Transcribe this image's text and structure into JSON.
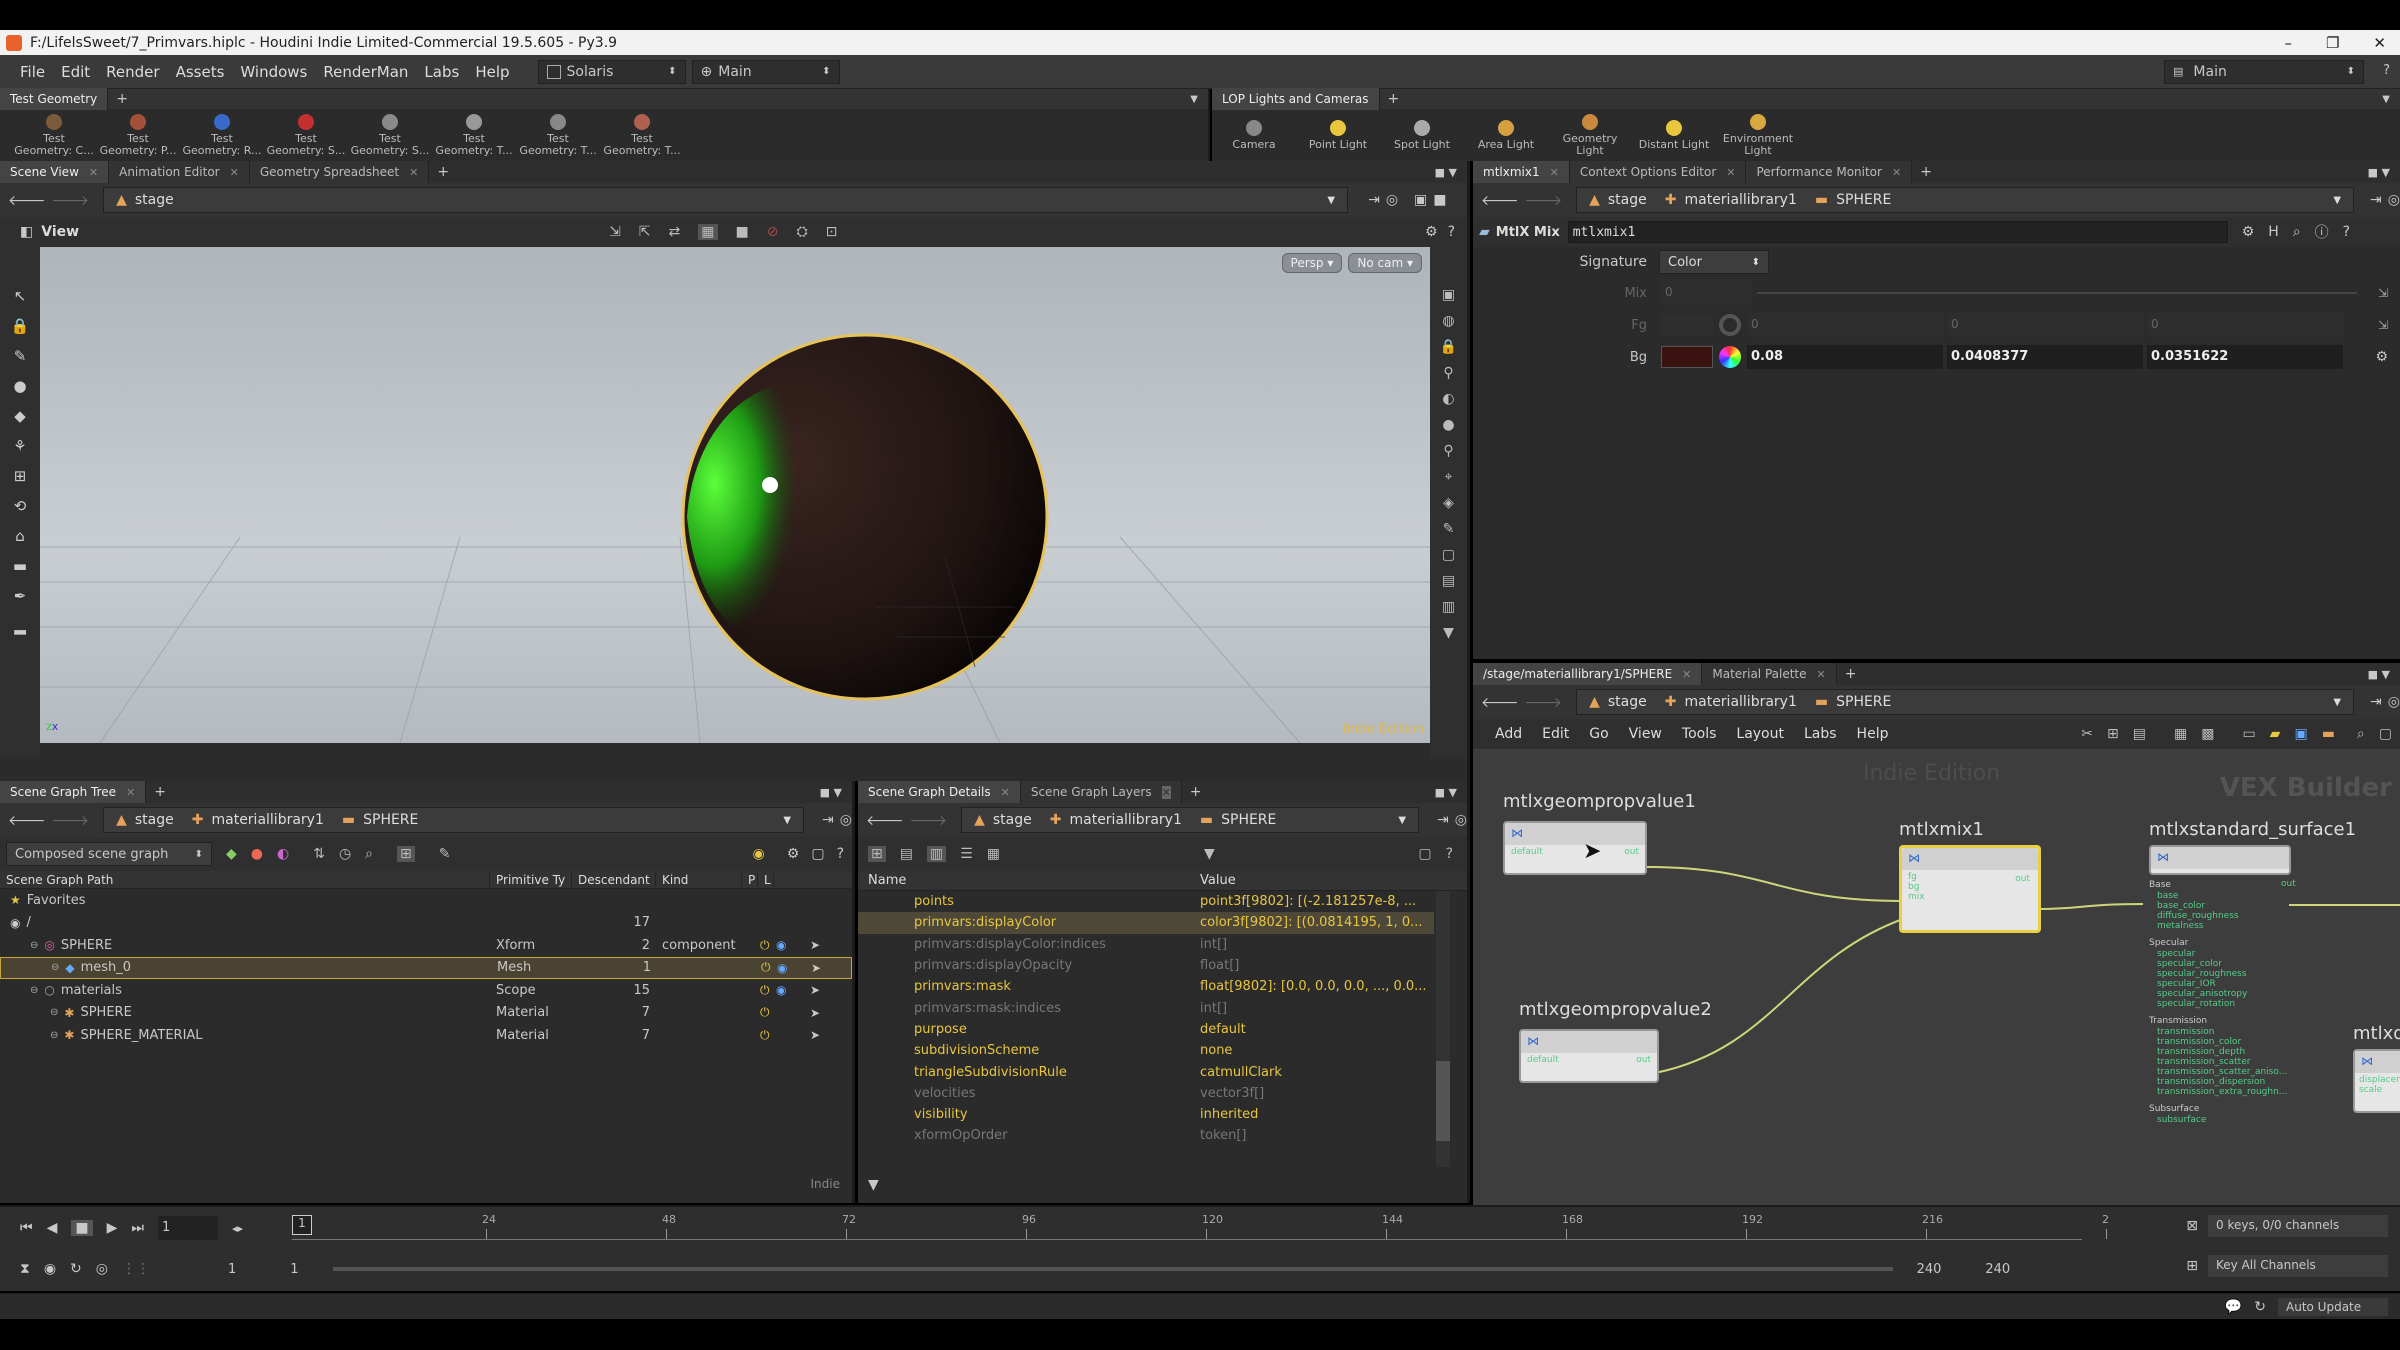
{
  "window": {
    "title": "F:/LifelsSweet/7_Primvars.hiplc - Houdini Indie Limited-Commercial 19.5.605 - Py3.9",
    "minimize": "–",
    "maximize": "❐",
    "close": "✕"
  },
  "menubar": {
    "items": [
      "File",
      "Edit",
      "Render",
      "Assets",
      "Windows",
      "RenderMan",
      "Labs",
      "Help"
    ],
    "context": "Solaris",
    "desktop": "Main",
    "right_desktop": "Main"
  },
  "shelf_left": {
    "tab": "Test Geometry",
    "tools": [
      {
        "l1": "Test",
        "l2": "Geometry: C..."
      },
      {
        "l1": "Test",
        "l2": "Geometry: P..."
      },
      {
        "l1": "Test",
        "l2": "Geometry: R..."
      },
      {
        "l1": "Test",
        "l2": "Geometry: S..."
      },
      {
        "l1": "Test",
        "l2": "Geometry: S..."
      },
      {
        "l1": "Test",
        "l2": "Geometry: T..."
      },
      {
        "l1": "Test",
        "l2": "Geometry: T..."
      },
      {
        "l1": "Test",
        "l2": "Geometry: T..."
      }
    ]
  },
  "shelf_right": {
    "tab": "LOP Lights and Cameras",
    "tools": [
      {
        "l1": "Camera",
        "l2": ""
      },
      {
        "l1": "Point Light",
        "l2": ""
      },
      {
        "l1": "Spot Light",
        "l2": ""
      },
      {
        "l1": "Area Light",
        "l2": ""
      },
      {
        "l1": "Geometry",
        "l2": "Light"
      },
      {
        "l1": "Distant Light",
        "l2": ""
      },
      {
        "l1": "Environment",
        "l2": "Light"
      }
    ]
  },
  "scene_view": {
    "tabs": [
      "Scene View",
      "Animation Editor",
      "Geometry Spreadsheet"
    ],
    "path": "stage",
    "view_label": "View",
    "persp": "Persp ▾",
    "cam": "No cam ▾",
    "watermark": "Indie Edition"
  },
  "param_pane": {
    "tabs": [
      "mtlxmix1",
      "Context Options Editor",
      "Performance Monitor"
    ],
    "path": [
      "stage",
      "materiallibrary1",
      "SPHERE"
    ],
    "node_type": "MtlX Mix",
    "node_name": "mtlxmix1",
    "signature_label": "Signature",
    "signature_value": "Color",
    "mix_label": "Mix",
    "mix_value": "0",
    "fg_label": "Fg",
    "fg_values": [
      "0",
      "0",
      "0"
    ],
    "bg_label": "Bg",
    "bg_values": [
      "0.08",
      "0.0408377",
      "0.0351622"
    ],
    "bg_swatch": "#3a1210"
  },
  "network": {
    "tabs": [
      "/stage/materiallibrary1/SPHERE",
      "Material Palette"
    ],
    "path": [
      "stage",
      "materiallibrary1",
      "SPHERE"
    ],
    "menu": [
      "Add",
      "Edit",
      "Go",
      "View",
      "Tools",
      "Layout",
      "Labs",
      "Help"
    ],
    "watermark": "Indie Edition",
    "context_label": "VEX Builder",
    "nodes": {
      "geom1": {
        "name": "mtlxgeompropvalue1",
        "in": "default",
        "out": "out"
      },
      "geom2": {
        "name": "mtlxgeompropvalue2",
        "in": "default",
        "out": "out"
      },
      "mix": {
        "name": "mtlxmix1",
        "inputs": [
          "fg",
          "bg",
          "mix"
        ],
        "out": "out"
      },
      "surface": {
        "name": "mtlxstandard_surface1",
        "out": "out"
      },
      "partial": {
        "name": "mtlxd",
        "inputs": [
          "displacem",
          "scale"
        ]
      }
    },
    "surface_groups": [
      {
        "title": "Base",
        "ports": [
          "base",
          "base_color",
          "diffuse_roughness",
          "metalness"
        ]
      },
      {
        "title": "Specular",
        "ports": [
          "specular",
          "specular_color",
          "specular_roughness",
          "specular_IOR",
          "specular_anisotropy",
          "specular_rotation"
        ]
      },
      {
        "title": "Transmission",
        "ports": [
          "transmission",
          "transmission_color",
          "transmission_depth",
          "transmission_scatter",
          "transmission_scatter_aniso...",
          "transmission_dispersion",
          "transmission_extra_roughn..."
        ]
      },
      {
        "title": "Subsurface",
        "ports": [
          "subsurface"
        ]
      }
    ]
  },
  "scene_graph": {
    "tab": "Scene Graph Tree",
    "path": [
      "stage",
      "materiallibrary1",
      "SPHERE"
    ],
    "filter": "Composed scene graph",
    "columns": [
      "Scene Graph Path",
      "Primitive Ty",
      "Descendant",
      "Kind",
      "P",
      "L",
      "",
      "",
      ""
    ],
    "rows": [
      {
        "name": "Favorites",
        "type": "",
        "desc": "",
        "kind": ""
      },
      {
        "name": "/",
        "type": "",
        "desc": "17",
        "kind": ""
      },
      {
        "name": "SPHERE",
        "type": "Xform",
        "desc": "2",
        "kind": "component"
      },
      {
        "name": "mesh_0",
        "type": "Mesh",
        "desc": "1",
        "kind": ""
      },
      {
        "name": "materials",
        "type": "Scope",
        "desc": "15",
        "kind": ""
      },
      {
        "name": "SPHERE",
        "type": "Material",
        "desc": "7",
        "kind": ""
      },
      {
        "name": "SPHERE_MATERIAL",
        "type": "Material",
        "desc": "7",
        "kind": ""
      }
    ],
    "watermark": "Indie"
  },
  "details": {
    "tabs": [
      "Scene Graph Details",
      "Scene Graph Layers"
    ],
    "path": [
      "stage",
      "materiallibrary1",
      "SPHERE"
    ],
    "columns": [
      "Name",
      "Value"
    ],
    "rows": [
      {
        "name": "points",
        "value": "point3f[9802]: [(-2.181257e-8, ...",
        "dim": false
      },
      {
        "name": "primvars:displayColor",
        "value": "color3f[9802]: [(0.0814195, 1, 0...",
        "dim": false
      },
      {
        "name": "primvars:displayColor:indices",
        "value": "int[]",
        "dim": true
      },
      {
        "name": "primvars:displayOpacity",
        "value": "float[]",
        "dim": true
      },
      {
        "name": "primvars:mask",
        "value": "float[9802]: [0.0, 0.0, 0.0, ..., 0.0...",
        "dim": false
      },
      {
        "name": "primvars:mask:indices",
        "value": "int[]",
        "dim": true
      },
      {
        "name": "purpose",
        "value": "default",
        "dim": false
      },
      {
        "name": "subdivisionScheme",
        "value": "none",
        "dim": false
      },
      {
        "name": "triangleSubdivisionRule",
        "value": "catmullClark",
        "dim": false
      },
      {
        "name": "velocities",
        "value": "vector3f[]",
        "dim": true
      },
      {
        "name": "visibility",
        "value": "inherited",
        "dim": false
      },
      {
        "name": "xformOpOrder",
        "value": "token[]",
        "dim": true
      }
    ]
  },
  "timeline": {
    "frame": "1",
    "current_marker": "1",
    "ticks": [
      "24",
      "48",
      "72",
      "96",
      "120",
      "144",
      "168",
      "192",
      "216",
      "2"
    ],
    "range_start": "1",
    "range_start2": "1",
    "range_end": "240",
    "range_end2": "240",
    "keys": "0 keys, 0/0 channels",
    "key_all": "Key All Channels",
    "auto_update": "Auto Update"
  }
}
